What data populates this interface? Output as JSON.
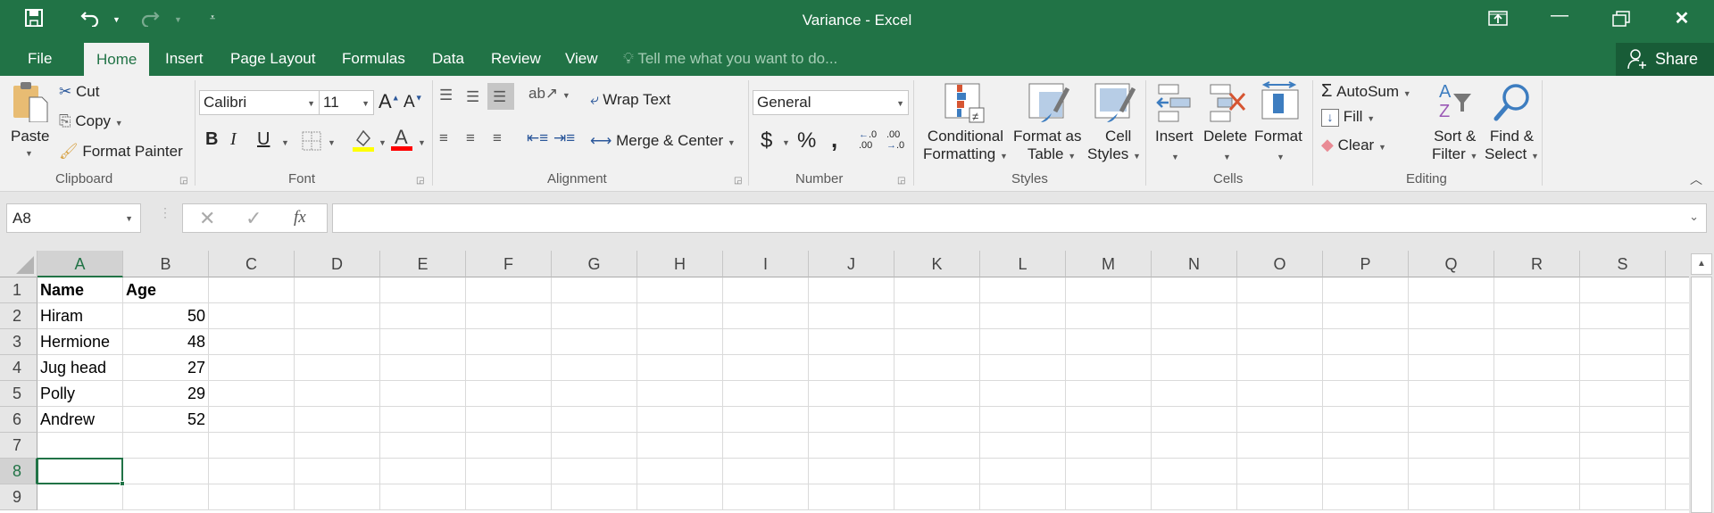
{
  "window": {
    "title": "Variance - Excel",
    "qat": {
      "save_icon": "save-icon",
      "undo_icon": "undo-icon",
      "redo_icon": "redo-icon",
      "customize_icon": "customize-qat-icon"
    },
    "controls": {
      "ribbon_display": "ribbon-display-options-icon",
      "minimize": "minimize-icon",
      "restore": "restore-icon",
      "close": "close-icon"
    }
  },
  "tabs": [
    {
      "label": "File"
    },
    {
      "label": "Home",
      "active": true
    },
    {
      "label": "Insert"
    },
    {
      "label": "Page Layout"
    },
    {
      "label": "Formulas"
    },
    {
      "label": "Data"
    },
    {
      "label": "Review"
    },
    {
      "label": "View"
    }
  ],
  "tell_me": {
    "placeholder": "Tell me what you want to do..."
  },
  "share": {
    "label": "Share"
  },
  "ribbon": {
    "clipboard": {
      "group": "Clipboard",
      "paste": "Paste",
      "cut": "Cut",
      "copy": "Copy",
      "format_painter": "Format Painter"
    },
    "font": {
      "group": "Font",
      "font_name": "Calibri",
      "font_size": "11",
      "bold": "B",
      "italic": "I",
      "underline": "U",
      "font_color": "#ff0000",
      "highlight_color": "#ffff00"
    },
    "alignment": {
      "group": "Alignment",
      "wrap_text": "Wrap Text",
      "merge_center": "Merge & Center"
    },
    "number": {
      "group": "Number",
      "format": "General",
      "currency": "$",
      "percent": "%",
      "comma": ","
    },
    "styles": {
      "group": "Styles",
      "conditional_1": "Conditional",
      "conditional_2": "Formatting",
      "format_table_1": "Format as",
      "format_table_2": "Table",
      "cell_styles_1": "Cell",
      "cell_styles_2": "Styles"
    },
    "cells": {
      "group": "Cells",
      "insert": "Insert",
      "delete": "Delete",
      "format": "Format"
    },
    "editing": {
      "group": "Editing",
      "autosum": "AutoSum",
      "fill": "Fill",
      "clear": "Clear",
      "sort_1": "Sort &",
      "sort_2": "Filter",
      "find_1": "Find &",
      "find_2": "Select"
    }
  },
  "formula_bar": {
    "name_box": "A8",
    "formula": "",
    "fx": "fx"
  },
  "sheet": {
    "columns": [
      "A",
      "B",
      "C",
      "D",
      "E",
      "F",
      "G",
      "H",
      "I",
      "J",
      "K",
      "L",
      "M",
      "N",
      "O",
      "P",
      "Q",
      "R",
      "S"
    ],
    "rows": [
      "1",
      "2",
      "3",
      "4",
      "5",
      "6",
      "7",
      "8",
      "9"
    ],
    "selected_cell": "A8",
    "cells": [
      {
        "ref": "A1",
        "value": "Name",
        "bold": true
      },
      {
        "ref": "B1",
        "value": "Age",
        "bold": true
      },
      {
        "ref": "A2",
        "value": "Hiram"
      },
      {
        "ref": "B2",
        "value": "50",
        "num": true
      },
      {
        "ref": "A3",
        "value": "Hermione"
      },
      {
        "ref": "B3",
        "value": "48",
        "num": true
      },
      {
        "ref": "A4",
        "value": "Jug head"
      },
      {
        "ref": "B4",
        "value": "27",
        "num": true
      },
      {
        "ref": "A5",
        "value": "Polly"
      },
      {
        "ref": "B5",
        "value": "29",
        "num": true
      },
      {
        "ref": "A6",
        "value": "Andrew"
      },
      {
        "ref": "B6",
        "value": "52",
        "num": true
      }
    ]
  }
}
